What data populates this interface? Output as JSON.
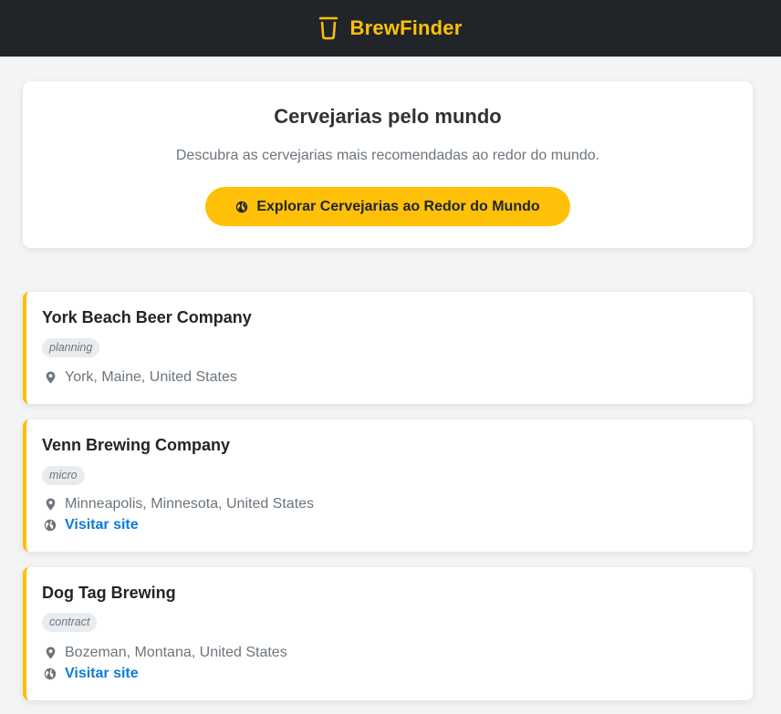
{
  "app": {
    "name": "BrewFinder",
    "accent_color": "#ffc107",
    "header_bg": "#212428",
    "brand_icon": "beer-glass-icon"
  },
  "hero": {
    "title": "Cervejarias pelo mundo",
    "subtitle": "Descubra as cervejarias mais recomendadas ao redor do mundo.",
    "button_label": "Explorar Cervejarias ao Redor do Mundo",
    "button_icon": "globe-icon"
  },
  "breweries": [
    {
      "name": "York Beach Beer Company",
      "type": "planning",
      "location": "York, Maine, United States"
    },
    {
      "name": "Venn Brewing Company",
      "type": "micro",
      "location": "Minneapolis, Minnesota, United States",
      "link_label": "Visitar site"
    },
    {
      "name": "Dog Tag Brewing",
      "type": "contract",
      "location": "Bozeman, Montana, United States",
      "link_label": "Visitar site"
    }
  ]
}
